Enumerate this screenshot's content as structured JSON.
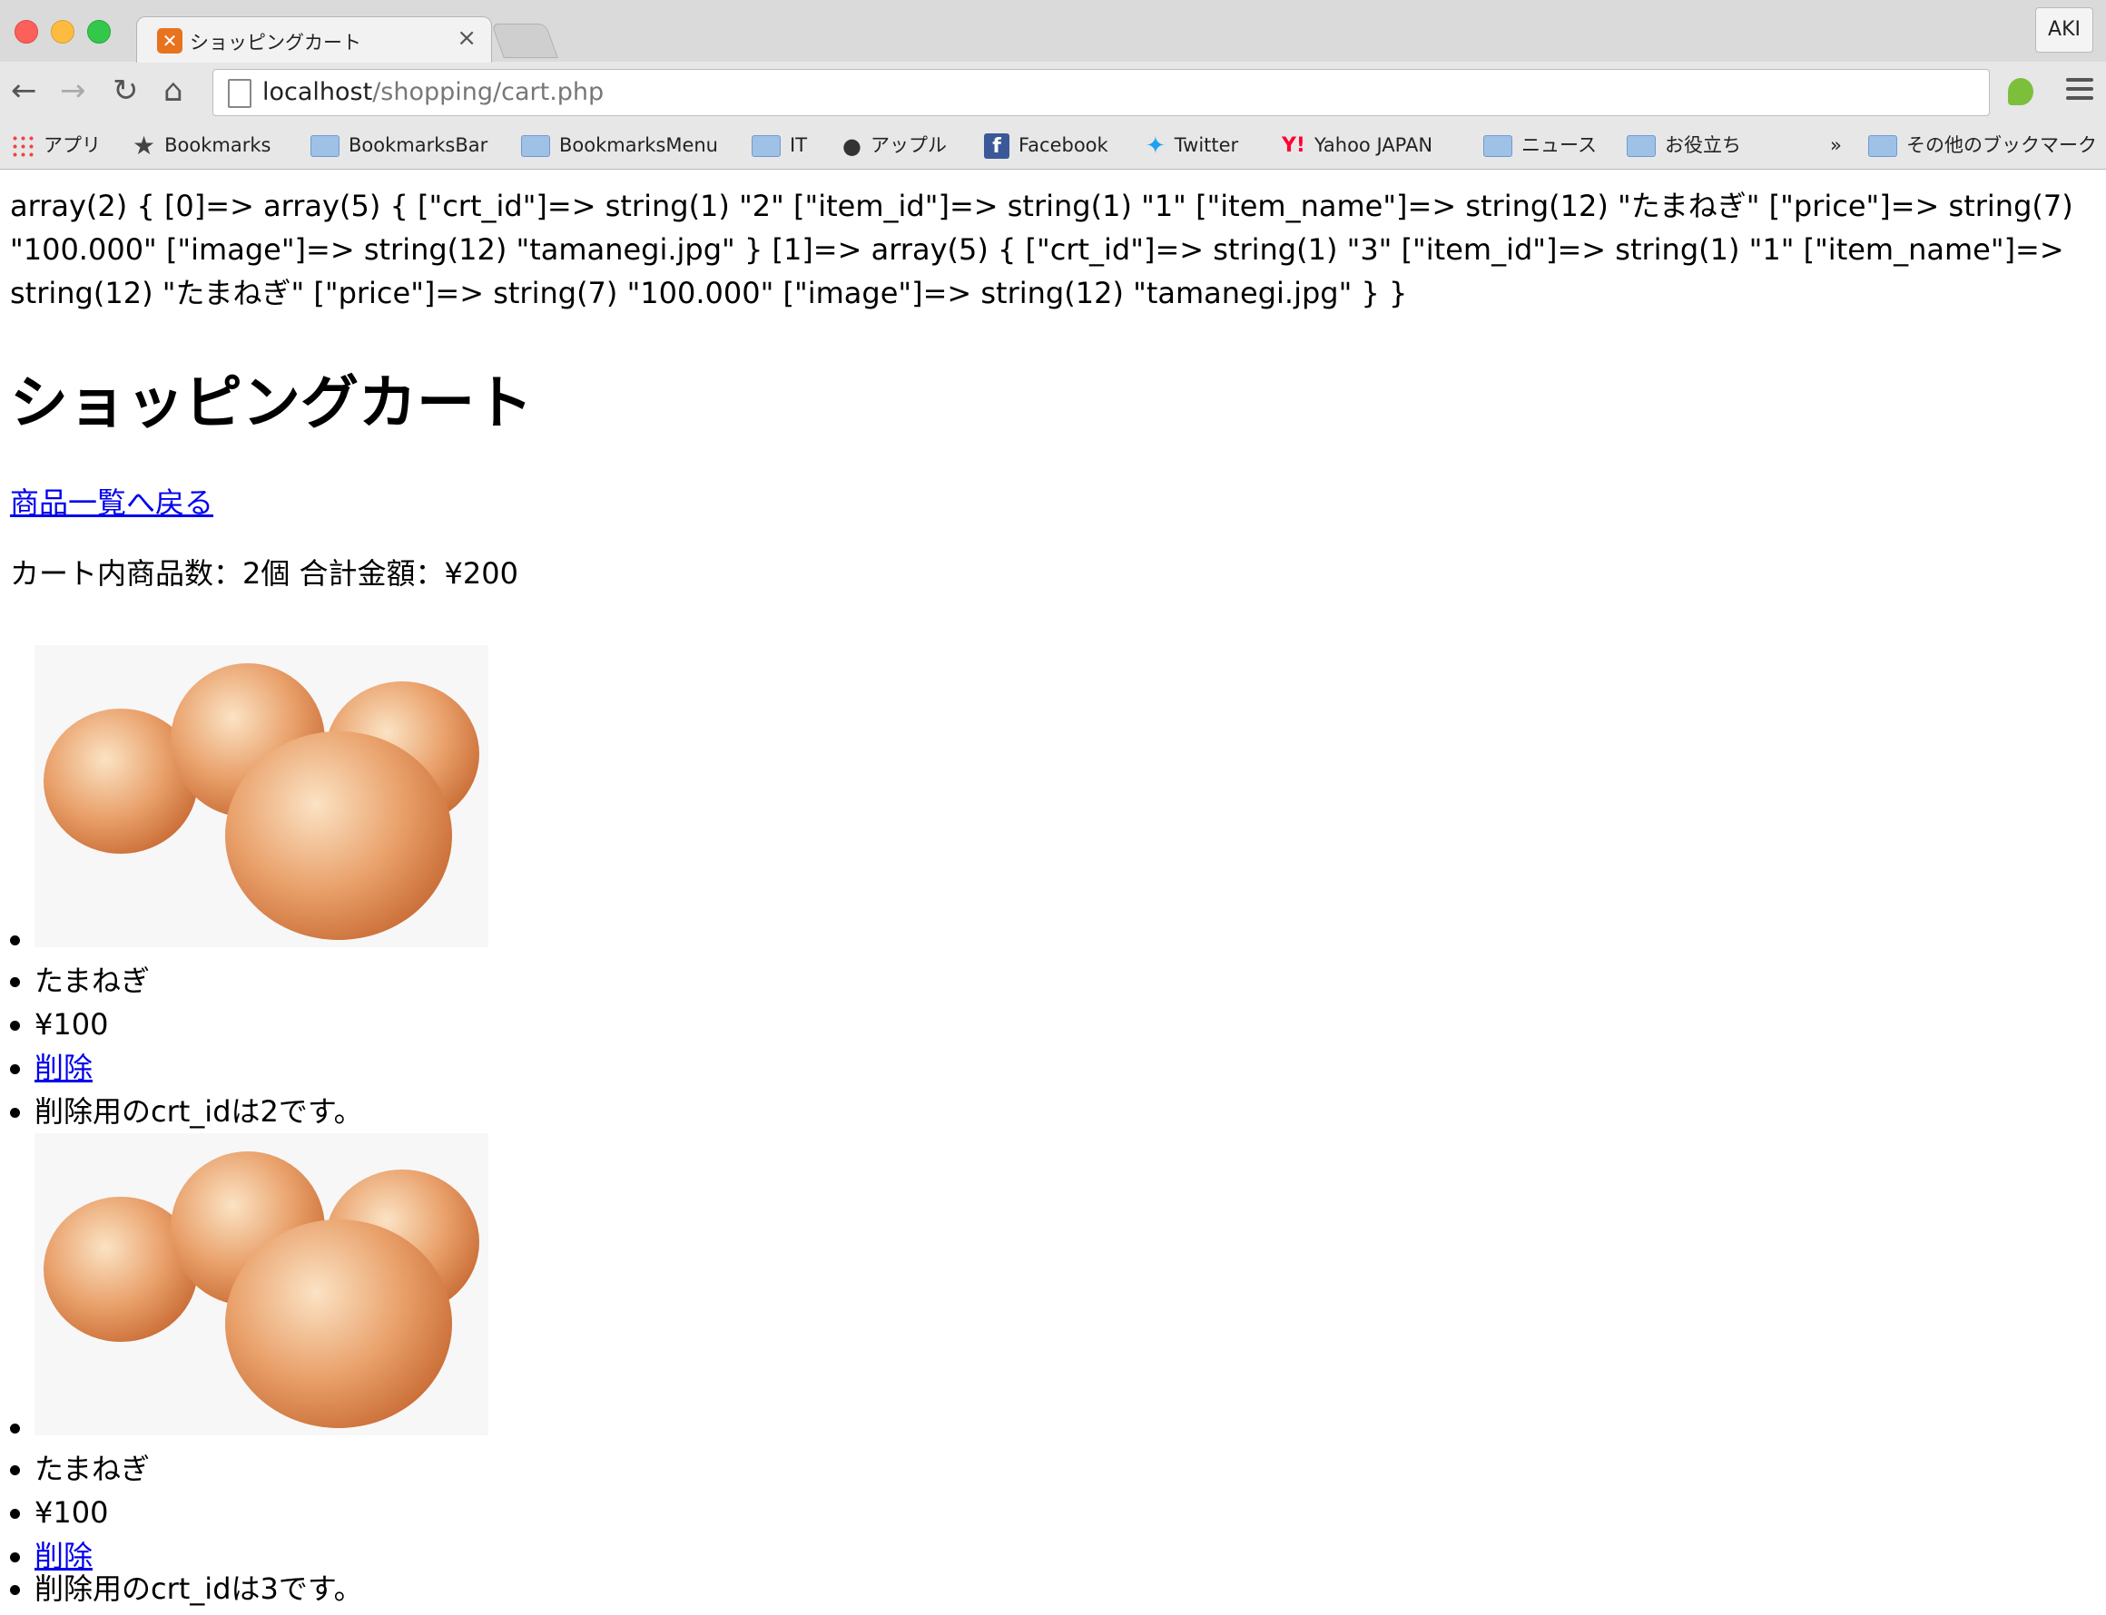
{
  "browser": {
    "tab_title": "ショッピングカート",
    "tab_close": "×",
    "profile_label": "AKI",
    "url_host": "localhost",
    "url_path": "/shopping/cart.php",
    "nav": {
      "back": "←",
      "forward": "→",
      "reload": "↻",
      "home": "⌂"
    }
  },
  "bookmarks": [
    {
      "label": "アプリ",
      "icon": "apps-grid-icon"
    },
    {
      "label": "Bookmarks",
      "icon": "star-icon"
    },
    {
      "label": "BookmarksBar",
      "icon": "folder-icon"
    },
    {
      "label": "BookmarksMenu",
      "icon": "folder-icon"
    },
    {
      "label": "IT",
      "icon": "folder-icon"
    },
    {
      "label": "アップル",
      "icon": "apple-icon"
    },
    {
      "label": "Facebook",
      "icon": "facebook-icon"
    },
    {
      "label": "Twitter",
      "icon": "twitter-icon"
    },
    {
      "label": "Yahoo JAPAN",
      "icon": "yahoo-icon"
    },
    {
      "label": "ニュース",
      "icon": "folder-icon"
    },
    {
      "label": "お役立ち",
      "icon": "folder-icon"
    },
    {
      "label": "»",
      "icon": "overflow-chevron-icon"
    },
    {
      "label": "その他のブックマーク",
      "icon": "folder-icon"
    }
  ],
  "page": {
    "dump": "array(2) { [0]=> array(5) { [\"crt_id\"]=> string(1) \"2\" [\"item_id\"]=> string(1) \"1\" [\"item_name\"]=> string(12) \"たまねぎ\" [\"price\"]=> string(7) \"100.000\" [\"image\"]=> string(12) \"tamanegi.jpg\" } [1]=> array(5) { [\"crt_id\"]=> string(1) \"3\" [\"item_id\"]=> string(1) \"1\" [\"item_name\"]=> string(12) \"たまねぎ\" [\"price\"]=> string(7) \"100.000\" [\"image\"]=> string(12) \"tamanegi.jpg\" } }",
    "title": "ショッピングカート",
    "back_link": "商品一覧へ戻る",
    "summary": "カート内商品数：2個 合計金額：¥200",
    "items": [
      {
        "name": "たまねぎ",
        "price": "¥100",
        "delete_label": "削除",
        "note": "削除用のcrt_idは2です。"
      },
      {
        "name": "たまねぎ",
        "price": "¥100",
        "delete_label": "削除",
        "note": "削除用のcrt_idは3です。"
      }
    ]
  }
}
